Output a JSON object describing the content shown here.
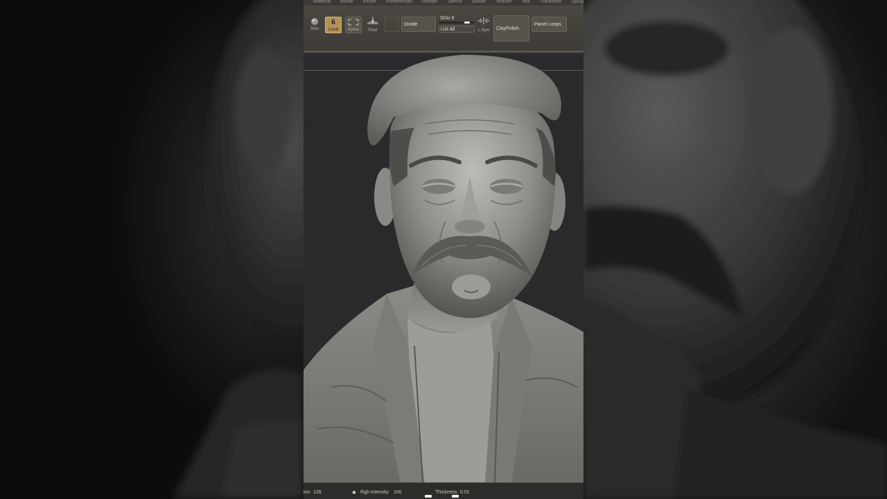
{
  "menu": [
    "Material",
    "Movie",
    "Picker",
    "Preferences",
    "Render",
    "Stencil",
    "Stroke",
    "Texture",
    "Tool",
    "Transform",
    "Zplugin"
  ],
  "toolbar": {
    "solo_label": "Solo",
    "local_label": "Local",
    "local_number": "6",
    "xpose_label": "Xpose",
    "floor_label": "Floor",
    "divide_label": "Divide",
    "sdiv_label": "SDiv 6",
    "list_all_label": "List All",
    "lsym_label": "L.Sym",
    "claypolish_label": "ClayPolish",
    "panel_loops_label": "Panel Loops",
    "sdiv_level": 0.83
  },
  "status": {
    "left_label": "ion",
    "left_value": "128",
    "rgb_label": "Rgb Intensity",
    "rgb_value": "100",
    "thickness_label": "Thickness",
    "thickness_value": "0.01"
  },
  "colors": {
    "panel": "#2b2b2d",
    "toolbar": "#4a4741",
    "active_button": "#b29258",
    "sculpt_clay": "#8a8985"
  },
  "icons": {
    "solo": "sphere-icon",
    "xpose": "xpose-icon",
    "floor": "floor-grid-icon",
    "lsym": "symmetry-icon"
  }
}
